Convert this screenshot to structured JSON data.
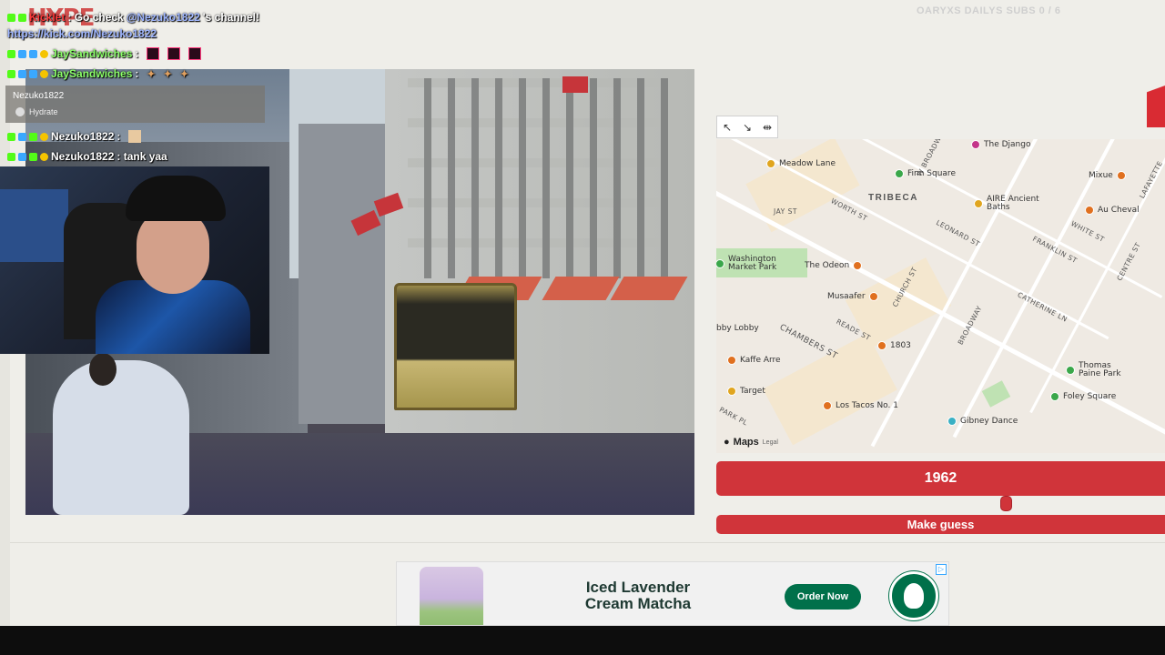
{
  "overlay": {
    "subs_counter": "OARYXS DAILYS SUBS 0 / 6",
    "hype_text": "HYPE"
  },
  "chat": {
    "lines": [
      {
        "user": "Kicklet",
        "message": ": Go check ",
        "mention": "@Nezuko1822",
        "suffix": "'s channel!"
      },
      {
        "link": "https://kick.com/Nezuko1822"
      },
      {
        "user": "JaySandwiches",
        "message": " :"
      },
      {
        "user": "JaySandwiches",
        "message": " :"
      },
      {
        "user": "Nezuko1822",
        "message": " :"
      },
      {
        "user": "Nezuko1822",
        "message": " : tank yaa"
      }
    ],
    "notification": {
      "name": "Nezuko1822",
      "text": "Hydrate"
    }
  },
  "map": {
    "toolbar": [
      "↖",
      "↘",
      "⇹"
    ],
    "neighborhood": "TRIBECA",
    "pois": [
      {
        "label": "The Django",
        "color": "#c4358a"
      },
      {
        "label": "Meadow Lane",
        "color": "#e0a51f"
      },
      {
        "label": "Finn Square",
        "color": "#3aa74a"
      },
      {
        "label": "Mixue",
        "color": "#e0701f"
      },
      {
        "label": "AIRE Ancient Baths",
        "color": "#e0a51f"
      },
      {
        "label": "Au Cheval",
        "color": "#e0701f"
      },
      {
        "label": "Washington Market Park",
        "color": "#3aa74a"
      },
      {
        "label": "The Odeon",
        "color": "#e0701f"
      },
      {
        "label": "Musaafer",
        "color": "#e0701f"
      },
      {
        "label": "bby Lobby",
        "color": "#ffffff"
      },
      {
        "label": "1803",
        "color": "#e0701f"
      },
      {
        "label": "Kaffe Arre",
        "color": "#e0701f"
      },
      {
        "label": "Thomas Paine Park",
        "color": "#3aa74a"
      },
      {
        "label": "Target",
        "color": "#e0a51f"
      },
      {
        "label": "Foley Square",
        "color": "#3aa74a"
      },
      {
        "label": "Los Tacos No. 1",
        "color": "#e0701f"
      },
      {
        "label": "Gibney Dance",
        "color": "#3ab0c4"
      }
    ],
    "streets": [
      "W BROADWAY",
      "WORTH ST",
      "JAY ST",
      "LEONARD ST",
      "FRANKLIN ST",
      "WHITE ST",
      "CHURCH ST",
      "BROADWAY",
      "CATHERINE LN",
      "CENTRE ST",
      "CHAMBERS ST",
      "READE ST",
      "PARK PL",
      "LAFAYETTE"
    ],
    "logo": "Maps",
    "legal": "Legal"
  },
  "game": {
    "year": "1962",
    "slider_fraction": 0.65,
    "guess_label": "Make guess"
  },
  "ad": {
    "headline": "Iced Lavender Cream Matcha",
    "cta": "Order Now",
    "adchoice": "▷"
  },
  "colors": {
    "accent": "#d0343a",
    "ad_green": "#00704a"
  }
}
